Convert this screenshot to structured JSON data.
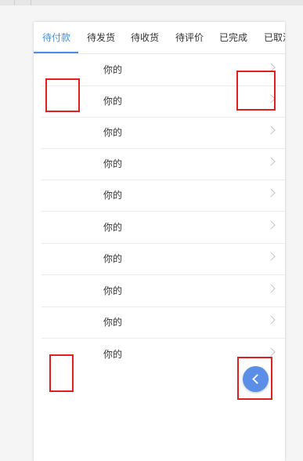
{
  "tabs": [
    {
      "label": "待付款",
      "active": true
    },
    {
      "label": "待发货",
      "active": false
    },
    {
      "label": "待收货",
      "active": false
    },
    {
      "label": "待评价",
      "active": false
    },
    {
      "label": "已完成",
      "active": false
    },
    {
      "label": "已取消",
      "active": false
    }
  ],
  "list": {
    "items": [
      {
        "label": "你的"
      },
      {
        "label": "你的"
      },
      {
        "label": "你的"
      },
      {
        "label": "你的"
      },
      {
        "label": "你的"
      },
      {
        "label": "你的"
      },
      {
        "label": "你的"
      },
      {
        "label": "你的"
      },
      {
        "label": "你的"
      },
      {
        "label": "你的"
      }
    ]
  },
  "icons": {
    "row_chevron": "chevron-right-icon",
    "back_button": "chevron-left-icon"
  },
  "colors": {
    "accent": "#4a90e2",
    "fab": "#5b8ee6",
    "highlight_box": "#e02020",
    "text": "#333333",
    "chevron": "#c4c4c4"
  }
}
